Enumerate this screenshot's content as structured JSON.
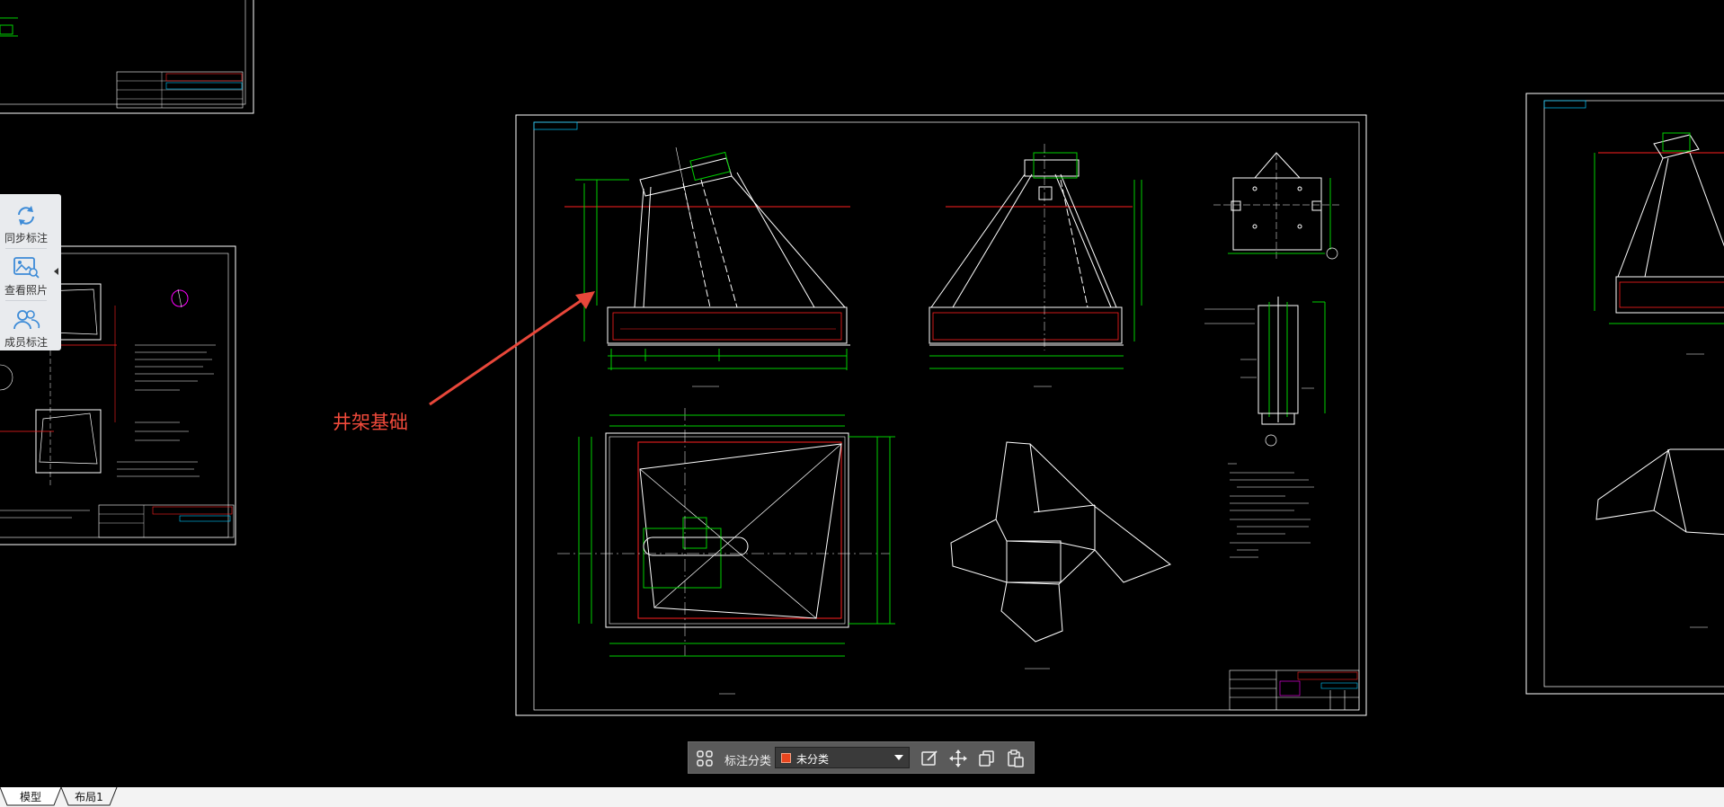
{
  "side_panel": {
    "items": [
      {
        "label": "同步标注",
        "icon": "sync-icon"
      },
      {
        "label": "查看照片",
        "icon": "photo-icon"
      },
      {
        "label": "成员标注",
        "icon": "members-icon"
      }
    ],
    "toggle_icon": "collapse-left-icon"
  },
  "annotation": {
    "label": "井架基础",
    "color": "#f04a3b"
  },
  "toolbar": {
    "grid_icon": "grid-icon",
    "category_label": "标注分类",
    "category_value": "未分类",
    "category_color": "#e8451e",
    "tools": [
      "edit-icon",
      "move-icon",
      "copy-icon",
      "paste-icon"
    ]
  },
  "tabs": [
    {
      "label": "模型",
      "active": true
    },
    {
      "label": "布局1",
      "active": false
    }
  ],
  "colors": {
    "background": "#000000",
    "line_white": "#ffffff",
    "dim_green": "#00d000",
    "red": "#ff2020",
    "cyan": "#00c8ff",
    "magenta": "#ff00ff"
  }
}
